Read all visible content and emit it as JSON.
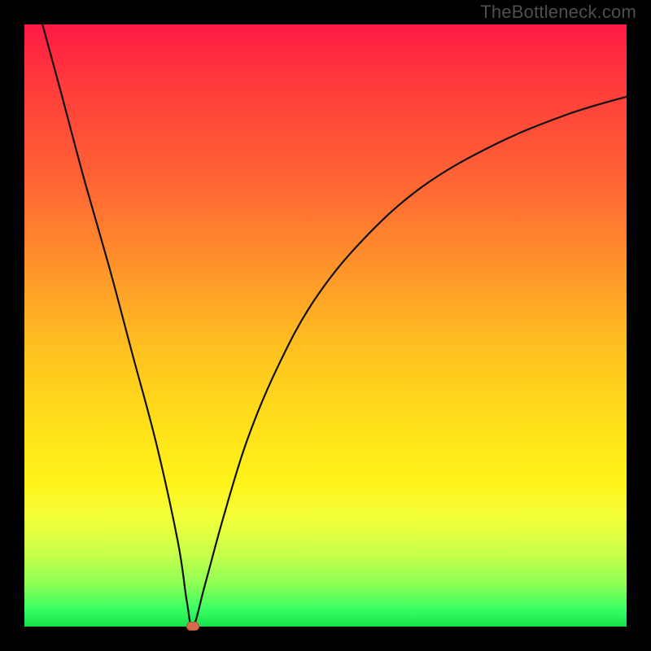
{
  "watermark": {
    "text": "TheBottleneck.com"
  },
  "colors": {
    "background": "#000000",
    "curve_stroke": "#111111",
    "marker_fill": "#d46a4a",
    "gradient_stops": [
      "#ff1a44",
      "#ff3b3b",
      "#ff6a33",
      "#ff9a2a",
      "#ffc41f",
      "#ffe11a",
      "#fff31a",
      "#f2ff3a",
      "#c7ff4a",
      "#8cff55",
      "#3aff62",
      "#17e24b"
    ]
  },
  "chart_data": {
    "type": "line",
    "title": "",
    "xlabel": "",
    "ylabel": "",
    "xlim": [
      0,
      100
    ],
    "ylim": [
      0,
      100
    ],
    "grid": false,
    "legend": false,
    "note": "Axes have no visible tick labels; values below are normalized 0-100 estimated from pixel positions. x runs left→right, y runs bottom→top.",
    "series": [
      {
        "name": "bottleneck-curve",
        "x": [
          3,
          6,
          10,
          14,
          18,
          22,
          25.5,
          27,
          28,
          30,
          33,
          37,
          42,
          48,
          56,
          66,
          78,
          90,
          100
        ],
        "y": [
          100,
          89,
          74,
          60,
          45,
          30,
          14,
          4,
          0,
          7,
          18,
          31,
          43,
          54,
          64,
          73,
          80,
          85,
          88
        ]
      }
    ],
    "points": [
      {
        "name": "minimum-marker",
        "x": 28,
        "y": 0
      }
    ]
  }
}
